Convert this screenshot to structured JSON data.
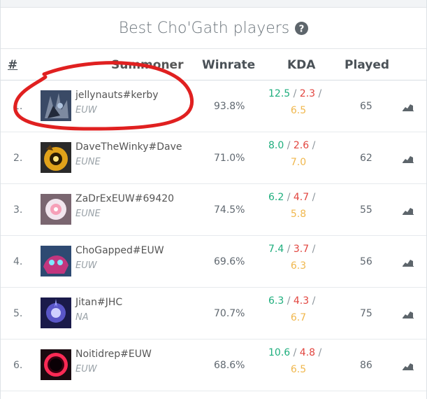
{
  "title": "Best Cho'Gath players",
  "icons": {
    "help": "question-circle-icon",
    "graph": "area-chart-icon"
  },
  "headers": {
    "rank": "#",
    "summoner": "Summoner",
    "winrate": "Winrate",
    "kda": "KDA",
    "played": "Played"
  },
  "colors": {
    "kills": "#1eae7d",
    "deaths": "#e2453f",
    "assists": "#f0b74d",
    "annotation": "#e02020"
  },
  "rows": [
    {
      "rank": "1.",
      "name": "jellynauts#kerby",
      "region": "EUW",
      "winrate": "93.8%",
      "k": "12.5",
      "d": "2.3",
      "a": "6.5",
      "played": "65"
    },
    {
      "rank": "2.",
      "name": "DaveTheWinky#Dave",
      "region": "EUNE",
      "winrate": "71.0%",
      "k": "8.0",
      "d": "2.6",
      "a": "7.0",
      "played": "62"
    },
    {
      "rank": "3.",
      "name": "ZaDrExEUW#69420",
      "region": "EUNE",
      "winrate": "74.5%",
      "k": "6.2",
      "d": "4.7",
      "a": "5.8",
      "played": "55"
    },
    {
      "rank": "4.",
      "name": "ChoGapped#EUW",
      "region": "EUW",
      "winrate": "69.6%",
      "k": "7.4",
      "d": "3.7",
      "a": "6.3",
      "played": "56"
    },
    {
      "rank": "5.",
      "name": "Jitan#JHC",
      "region": "NA",
      "winrate": "70.7%",
      "k": "6.3",
      "d": "4.3",
      "a": "6.7",
      "played": "75"
    },
    {
      "rank": "6.",
      "name": "Noitidrep#EUW",
      "region": "EUW",
      "winrate": "68.6%",
      "k": "10.6",
      "d": "4.8",
      "a": "6.5",
      "played": "86"
    }
  ],
  "kda_separator": " / "
}
